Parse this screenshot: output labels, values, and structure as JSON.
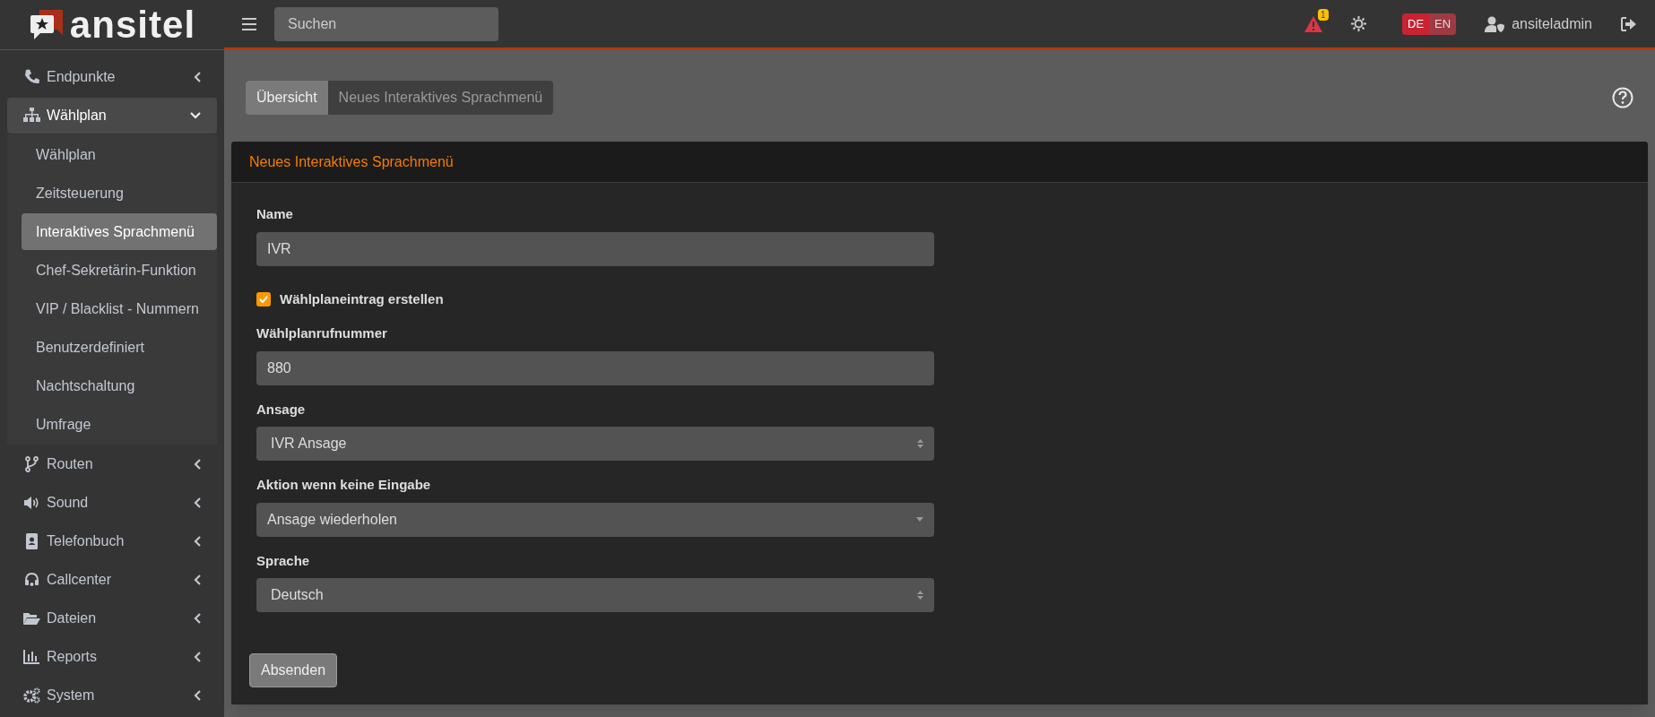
{
  "logo": {
    "text": "ansitel"
  },
  "search": {
    "placeholder": "Suchen"
  },
  "header": {
    "alert_count": "1",
    "languages": [
      {
        "label": "DE",
        "selected": true
      },
      {
        "label": "EN",
        "selected": false
      }
    ],
    "user": "ansiteladmin"
  },
  "sidebar": {
    "items": [
      {
        "label": "Endpunkte",
        "expanded": false
      },
      {
        "label": "Wählplan",
        "expanded": true,
        "children": [
          {
            "label": "Wählplan",
            "selected": false
          },
          {
            "label": "Zeitsteuerung",
            "selected": false
          },
          {
            "label": "Interaktives Sprachmenü",
            "selected": true
          },
          {
            "label": "Chef-Sekretärin-Funktion",
            "selected": false
          },
          {
            "label": "VIP / Blacklist - Nummern",
            "selected": false
          },
          {
            "label": "Benutzerdefiniert",
            "selected": false
          },
          {
            "label": "Nachtschaltung",
            "selected": false
          },
          {
            "label": "Umfrage",
            "selected": false
          }
        ]
      },
      {
        "label": "Routen",
        "expanded": false
      },
      {
        "label": "Sound",
        "expanded": false
      },
      {
        "label": "Telefonbuch",
        "expanded": false
      },
      {
        "label": "Callcenter",
        "expanded": false
      },
      {
        "label": "Dateien",
        "expanded": false
      },
      {
        "label": "Reports",
        "expanded": false
      },
      {
        "label": "System",
        "expanded": false
      }
    ]
  },
  "tabs": [
    {
      "label": "Übersicht",
      "selected": true
    },
    {
      "label": "Neues Interaktives Sprachmenü",
      "selected": false
    }
  ],
  "card": {
    "title": "Neues Interaktives Sprachmenü",
    "fields": [
      {
        "kind": "text",
        "label": "Name",
        "value": "IVR"
      },
      {
        "kind": "checkbox",
        "label": "Wählplaneintrag erstellen",
        "checked": true
      },
      {
        "kind": "text",
        "label": "Wählplanrufnummer",
        "value": "880"
      },
      {
        "kind": "select",
        "label": "Ansage",
        "value": "IVR Ansage"
      },
      {
        "kind": "dropdown",
        "label": "Aktion wenn keine Eingabe",
        "value": "Ansage wiederholen"
      },
      {
        "kind": "select",
        "label": "Sprache",
        "value": "Deutsch"
      }
    ],
    "submit": "Absenden"
  }
}
